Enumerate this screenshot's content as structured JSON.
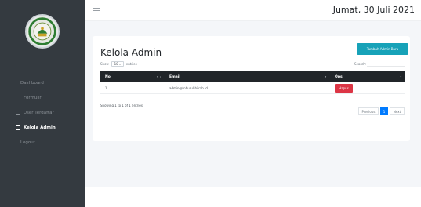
{
  "topbar": {
    "date": "Jumat, 30 Juli 2021"
  },
  "sidebar": {
    "items": [
      {
        "label": "Dashboard",
        "icon": "none"
      },
      {
        "label": "Formulir",
        "icon": "form-icon"
      },
      {
        "label": "User Terdaftar",
        "icon": "users-icon"
      },
      {
        "label": "Kelola Admin",
        "icon": "admin-icon",
        "active": true
      },
      {
        "label": "Logout",
        "icon": "none"
      }
    ]
  },
  "main": {
    "title": "Kelola Admin",
    "add_button": "Tambah Admin Baru",
    "show_label": "Show",
    "show_value": "10",
    "entries_label": "entries",
    "search_label": "Search:",
    "columns": [
      "No",
      "Email",
      "Opsi"
    ],
    "rows": [
      {
        "no": "1",
        "email": "admin@tnhurul-hijrah.id",
        "action": "Hapus"
      }
    ],
    "info": "Showing 1 to 1 of 1 entries",
    "pagination": {
      "previous": "Previous",
      "page": "1",
      "next": "Next"
    }
  },
  "colors": {
    "sidebar": "#343a40",
    "accent": "#17a2b8",
    "danger": "#dc3545",
    "primary": "#007bff",
    "table_header": "#212529"
  }
}
